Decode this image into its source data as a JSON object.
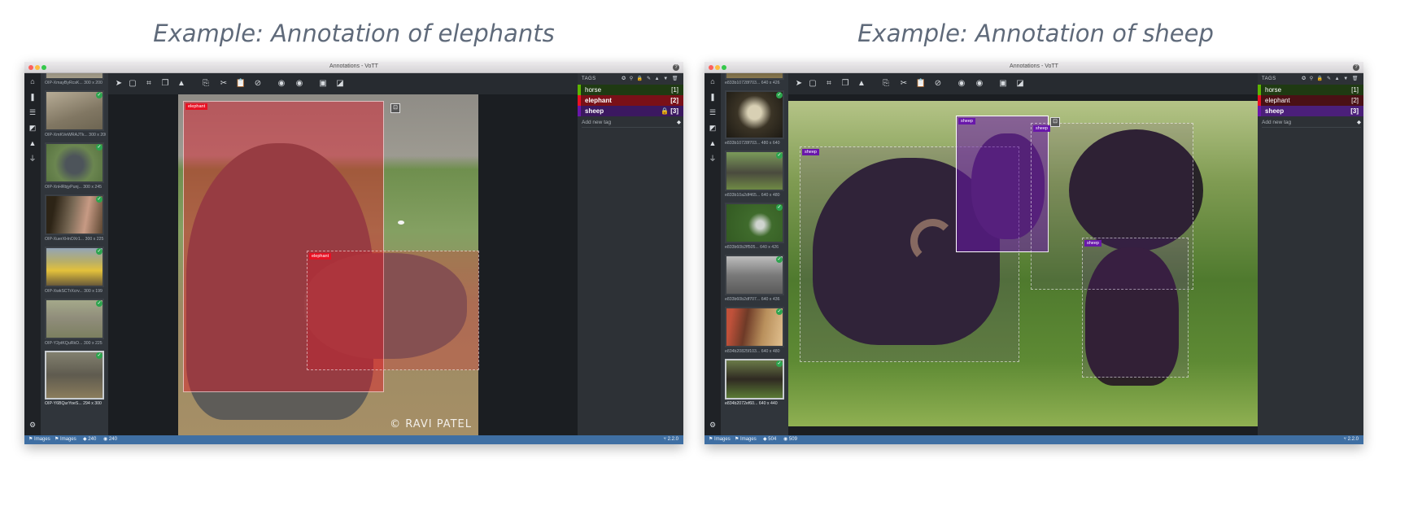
{
  "captions": {
    "left": "Example: Annotation of elephants",
    "right": "Example: Annotation of sheep"
  },
  "window_title": "Annotations - VoTT",
  "left_nav_icons": [
    "home-icon",
    "bookmark-icon",
    "sliders-icon",
    "edit-image-icon",
    "graduation-cap-icon",
    "plug-icon",
    "settings-icon"
  ],
  "toolbar_icons": [
    "pointer-icon",
    "rectangle-icon",
    "polygon-icon",
    "copy-rectangle-icon",
    "active-learning-icon",
    "copy-icon",
    "cut-icon",
    "paste-icon",
    "clear-icon",
    "previous-asset-icon",
    "next-asset-icon",
    "save-icon",
    "export-icon"
  ],
  "tags_panel": {
    "title": "TAGS",
    "tools": "✪ ⚲ 🔒 ✎ ▲ ▼ 🗑",
    "add_new_tag": "Add new tag",
    "tags": [
      {
        "name": "horse",
        "hotkey": "[1]",
        "color": "#5db300"
      },
      {
        "name": "elephant",
        "hotkey": "[2]",
        "color": "#e81123"
      },
      {
        "name": "sheep",
        "hotkey": "[3]",
        "color": "#6917aa",
        "locked": true
      }
    ]
  },
  "elephant_window": {
    "thumbs": [
      "OIP-XmayByRcsK... 300 x 200",
      "OIP-XmKVeWRAJTk... 300 x 200",
      "OIP-XnHRbjyPunj... 300 x 245",
      "OIP-XuerXHnOXr1... 300 x 225",
      "OIP-XwkSCTrXcrv... 300 x 199",
      "OIP-Y2ptKQuRkO... 300 x 225",
      "OIP-Y6BQurYoeS... 294 x 300"
    ],
    "regions": [
      {
        "tag": "elephant",
        "color": "#e81123"
      },
      {
        "tag": "elephant",
        "color": "#e81123"
      }
    ],
    "watermark": "© RAVI PATEL",
    "status": {
      "items1": "Images",
      "items2": "Images",
      "tags": "240",
      "visited": "240",
      "version": "2.2.0"
    }
  },
  "sheep_window": {
    "thumbs": [
      "e833b10728f703... 640 x 426",
      "e833b10728f703... 480 x 640",
      "e833b10a2df465... 640 x 480",
      "e833b60b2ff505... 640 x 426",
      "e833b60b2df707... 640 x 436",
      "e834b20825f103... 640 x 480",
      "e834b2072ef60... 640 x 440"
    ],
    "regions": [
      {
        "tag": "sheep",
        "color": "#6917aa"
      },
      {
        "tag": "sheep",
        "color": "#6917aa"
      },
      {
        "tag": "sheep",
        "color": "#6917aa"
      },
      {
        "tag": "sheep",
        "color": "#6917aa"
      }
    ],
    "status": {
      "items1": "Images",
      "items2": "Images",
      "tags": "504",
      "visited": "509",
      "version": "2.2.0"
    }
  }
}
